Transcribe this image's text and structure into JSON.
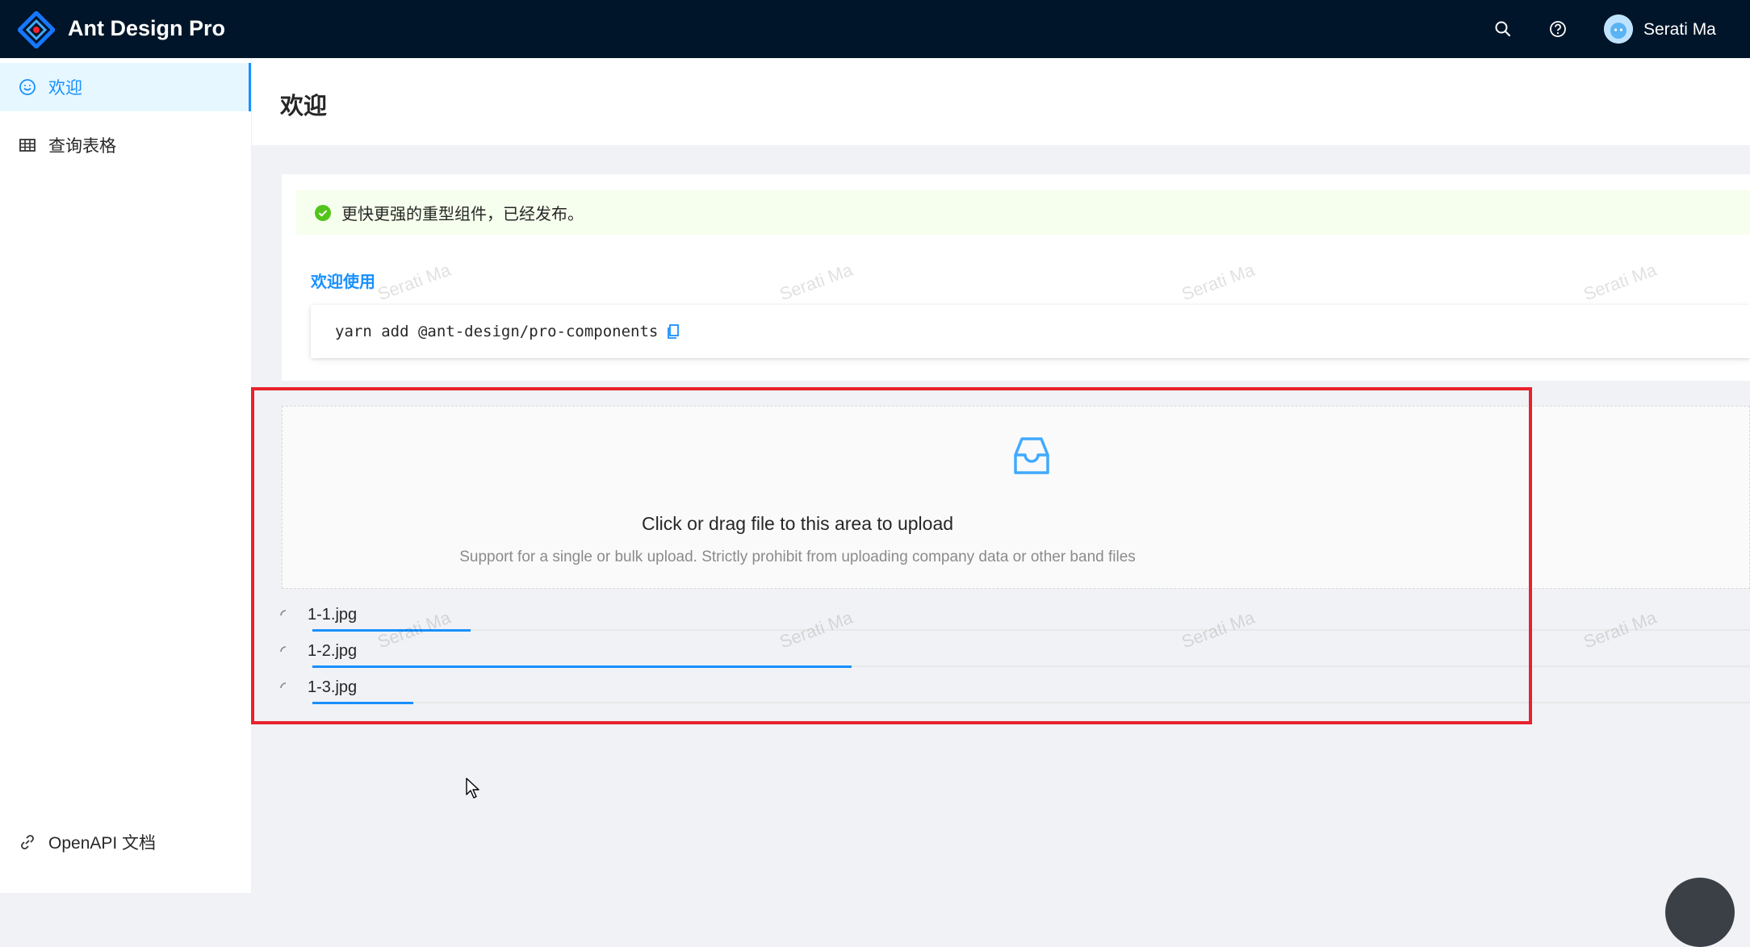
{
  "header": {
    "title": "Ant Design Pro",
    "user_name": "Serati Ma",
    "icons": [
      "search-icon",
      "question-circle-icon"
    ]
  },
  "sidebar": {
    "items": [
      {
        "label": "欢迎",
        "icon": "smile-icon",
        "active": true
      },
      {
        "label": "查询表格",
        "icon": "table-icon",
        "active": false
      }
    ],
    "footer_items": [
      {
        "label": "OpenAPI 文档",
        "icon": "link-icon"
      }
    ]
  },
  "page": {
    "title": "欢迎"
  },
  "card": {
    "alert_text": "更快更强的重型组件，已经发布。",
    "welcome_link": "欢迎使用",
    "code": "yarn add @ant-design/pro-components"
  },
  "upload": {
    "text": "Click or drag file to this area to upload",
    "hint": "Support for a single or bulk upload. Strictly prohibit from uploading company data or other band files",
    "files": [
      {
        "name": "1-1.jpg",
        "progress": 0.11,
        "status": "uploading"
      },
      {
        "name": "1-2.jpg",
        "progress": 0.375,
        "status": "uploading"
      },
      {
        "name": "1-3.jpg",
        "progress": 0.07,
        "status": "uploading"
      }
    ]
  },
  "watermark": "Serati Ma",
  "colors": {
    "header_bg": "#001529",
    "primary": "#1890ff",
    "alert_bg": "#f6ffed",
    "success": "#52c41a",
    "highlight_border": "#e8222c"
  }
}
